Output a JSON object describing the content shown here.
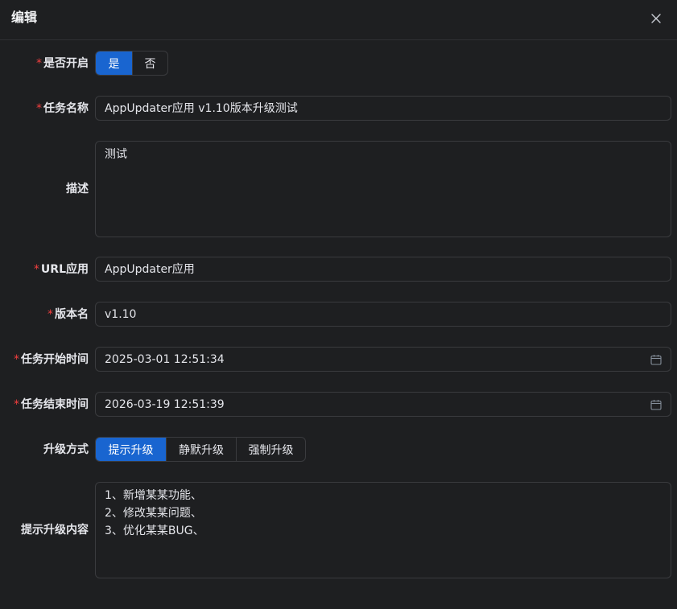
{
  "dialog": {
    "title": "编辑",
    "close_icon": "close-icon"
  },
  "form": {
    "required_mark": "*",
    "enabled": {
      "label": "是否开启",
      "options": [
        "是",
        "否"
      ],
      "selected": "是"
    },
    "task_name": {
      "label": "任务名称",
      "value": "AppUpdater应用 v1.10版本升级测试"
    },
    "description": {
      "label": "描述",
      "value": "测试"
    },
    "url_app": {
      "label": "URL应用",
      "value": "AppUpdater应用"
    },
    "version_name": {
      "label": "版本名",
      "value": "v1.10"
    },
    "start_time": {
      "label": "任务开始时间",
      "value": "2025-03-01 12:51:34",
      "icon": "calendar-icon"
    },
    "end_time": {
      "label": "任务结束时间",
      "value": "2026-03-19 12:51:39",
      "icon": "calendar-icon"
    },
    "upgrade_mode": {
      "label": "升级方式",
      "options": [
        "提示升级",
        "静默升级",
        "强制升级"
      ],
      "selected": "提示升级"
    },
    "upgrade_content": {
      "label": "提示升级内容",
      "lines": [
        "1、新增某某功能、",
        "2、修改某某问题、",
        "3、优化某某BUG、"
      ]
    }
  },
  "colors": {
    "accent": "#1965d0",
    "required": "#f53f3f",
    "background": "#1e1f21",
    "border": "#3a3b3e"
  }
}
